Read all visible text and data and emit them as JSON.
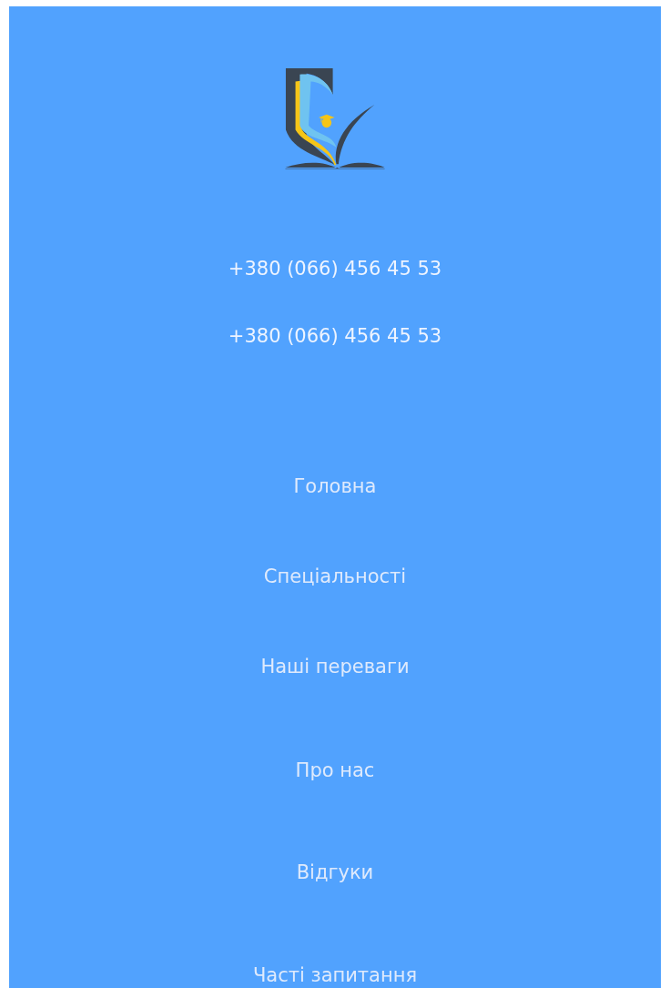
{
  "phones": [
    "+380 (066) 456 45 53",
    "+380 (066) 456 45 53"
  ],
  "nav": [
    {
      "label": "Головна"
    },
    {
      "label": "Спеціальності"
    },
    {
      "label": "Наші переваги"
    },
    {
      "label": "Про нас"
    },
    {
      "label": "Відгуки"
    },
    {
      "label": "Часті запитання"
    }
  ]
}
